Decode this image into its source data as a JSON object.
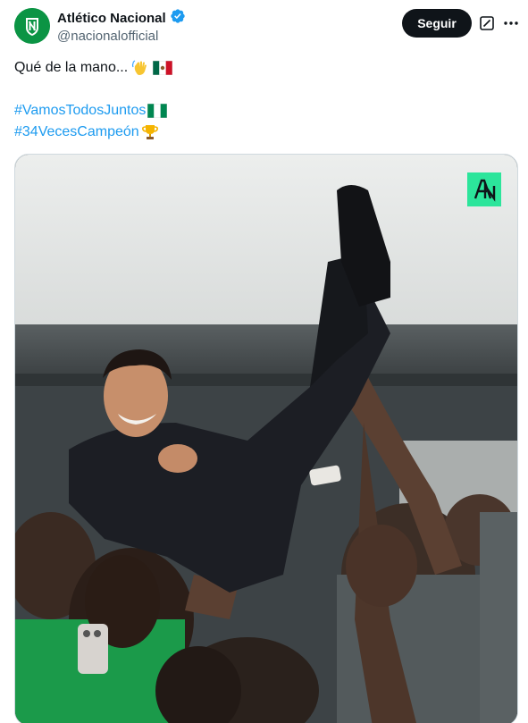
{
  "author": {
    "display_name": "Atlético Nacional",
    "handle": "@nacionalofficial",
    "verified": true,
    "avatar_color": "#0b9444"
  },
  "header": {
    "follow_label": "Seguir",
    "grok_icon": "grok-icon",
    "more_icon": "more-icon"
  },
  "tweet": {
    "line1": "Qué de la mano...",
    "hashtag1": "#VamosTodosJuntos",
    "hashtag2": "#34VecesCampeón",
    "emojis": [
      "waving-hand-icon",
      "mexico-flag-icon",
      "nigeria-flag-icon",
      "trophy-icon"
    ]
  },
  "media": {
    "description_icon": "photo",
    "logo_icon": "an-logo-icon",
    "logo_color": "#2ce59b"
  },
  "colors": {
    "link": "#1d9bf0",
    "text": "#0f1419",
    "secondary": "#536471",
    "verified": "#1d9bf0"
  }
}
